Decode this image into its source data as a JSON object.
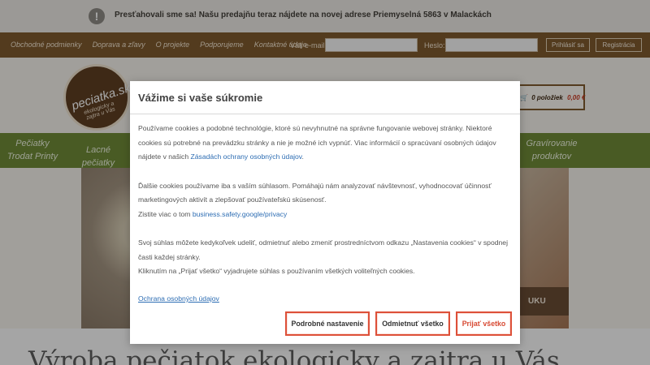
{
  "notice": {
    "icon": "exclamation-circle-icon",
    "text": "Presťahovali sme sa! Našu predajňu teraz nájdete na novej adrese Priemyselná 5863 v Malackách"
  },
  "topbar": {
    "links": [
      "Obchodné podmienky",
      "Doprava a zľavy",
      "O projekte",
      "Podporujeme",
      "Kontaktné údaje"
    ],
    "email_label": "Váš e-mail:",
    "password_label": "Heslo:",
    "login_button": "Prihlásiť sa",
    "register_button": "Registrácia"
  },
  "logo": {
    "name": "peciatka.sk",
    "tagline": "ekologicky a zajtra u Vás"
  },
  "cart": {
    "icon": "cart-icon",
    "count": "0 položiek",
    "price": "0,00 €"
  },
  "categories": [
    {
      "line1": "Pečiatky",
      "line2": "Trodat Printy"
    },
    {
      "line1": "Lacné pečiatky",
      "line2": ""
    },
    {
      "line1": "Gravírovanie",
      "line2": "produktov"
    }
  ],
  "hero": {
    "band_text": "UKU"
  },
  "page": {
    "heading": "Výroba pečiatok ekologicky a zajtra u Vás"
  },
  "modal": {
    "title": "Vážime si vaše súkromie",
    "p1": "Používame cookies a podobné technológie, ktoré sú nevyhnutné na správne fungovanie webovej stránky. Niektoré cookies sú potrebné na prevádzku stránky a nie je možné ich vypnúť. Viac informácií o spracúvaní osobných údajov nájdete v našich ",
    "p1_link": "Zásadách ochrany osobných údajov",
    "p1_end": ".",
    "p2": "Ďalšie cookies používame iba s vaším súhlasom. Pomáhajú nám analyzovať návštevnosť, vyhodnocovať účinnosť marketingových aktivít a zlepšovať používateľskú skúsenosť.",
    "p2b": "Zistite viac o tom ",
    "p2_link": "business.safety.google/privacy",
    "p3a": "Svoj súhlas môžete kedykoľvek udeliť, odmietnuť alebo zmeniť prostredníctvom odkazu „Nastavenia cookies“ v spodnej časti každej stránky.",
    "p3b": "Kliknutím na „Prijať všetko“ vyjadrujete súhlas s používaním všetkých voliteľných cookies.",
    "privacy_link": "Ochrana osobných údajov",
    "buttons": {
      "details": "Podrobné nastavenie",
      "reject": "Odmietnuť všetko",
      "accept": "Prijať všetko"
    }
  }
}
